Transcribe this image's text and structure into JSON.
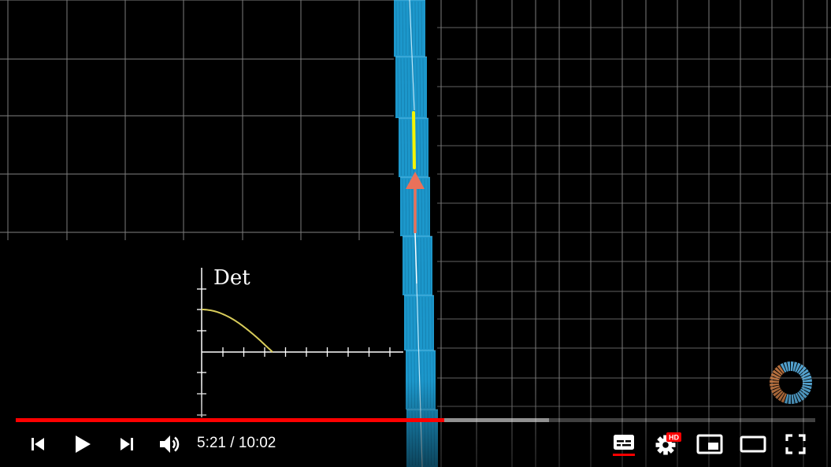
{
  "player": {
    "time_current": "5:21",
    "time_separator": " / ",
    "time_duration": "10:02",
    "progress_played_fraction": 0.536,
    "progress_loaded_fraction": 0.667,
    "settings_badge": "HD"
  },
  "video_frame": {
    "inset_label": "Det"
  },
  "colors": {
    "progress_played": "#ff0000",
    "captions_underline": "#ff0000",
    "hd_badge": "#ff0000",
    "stripe": "#1e9fd6",
    "vector_arrow": "#e9715a",
    "vector_yellow": "#f5f500",
    "curve": "#d8cc5a",
    "grid": "#7a7a7a"
  },
  "icons": {
    "previous": "previous-icon",
    "play": "play-icon",
    "next": "next-icon",
    "volume": "volume-icon",
    "captions": "captions-icon",
    "settings": "gear-icon",
    "miniplayer": "miniplayer-icon",
    "theater": "theater-mode-icon",
    "fullscreen": "fullscreen-icon",
    "loading": "loading-spinner-icon"
  }
}
